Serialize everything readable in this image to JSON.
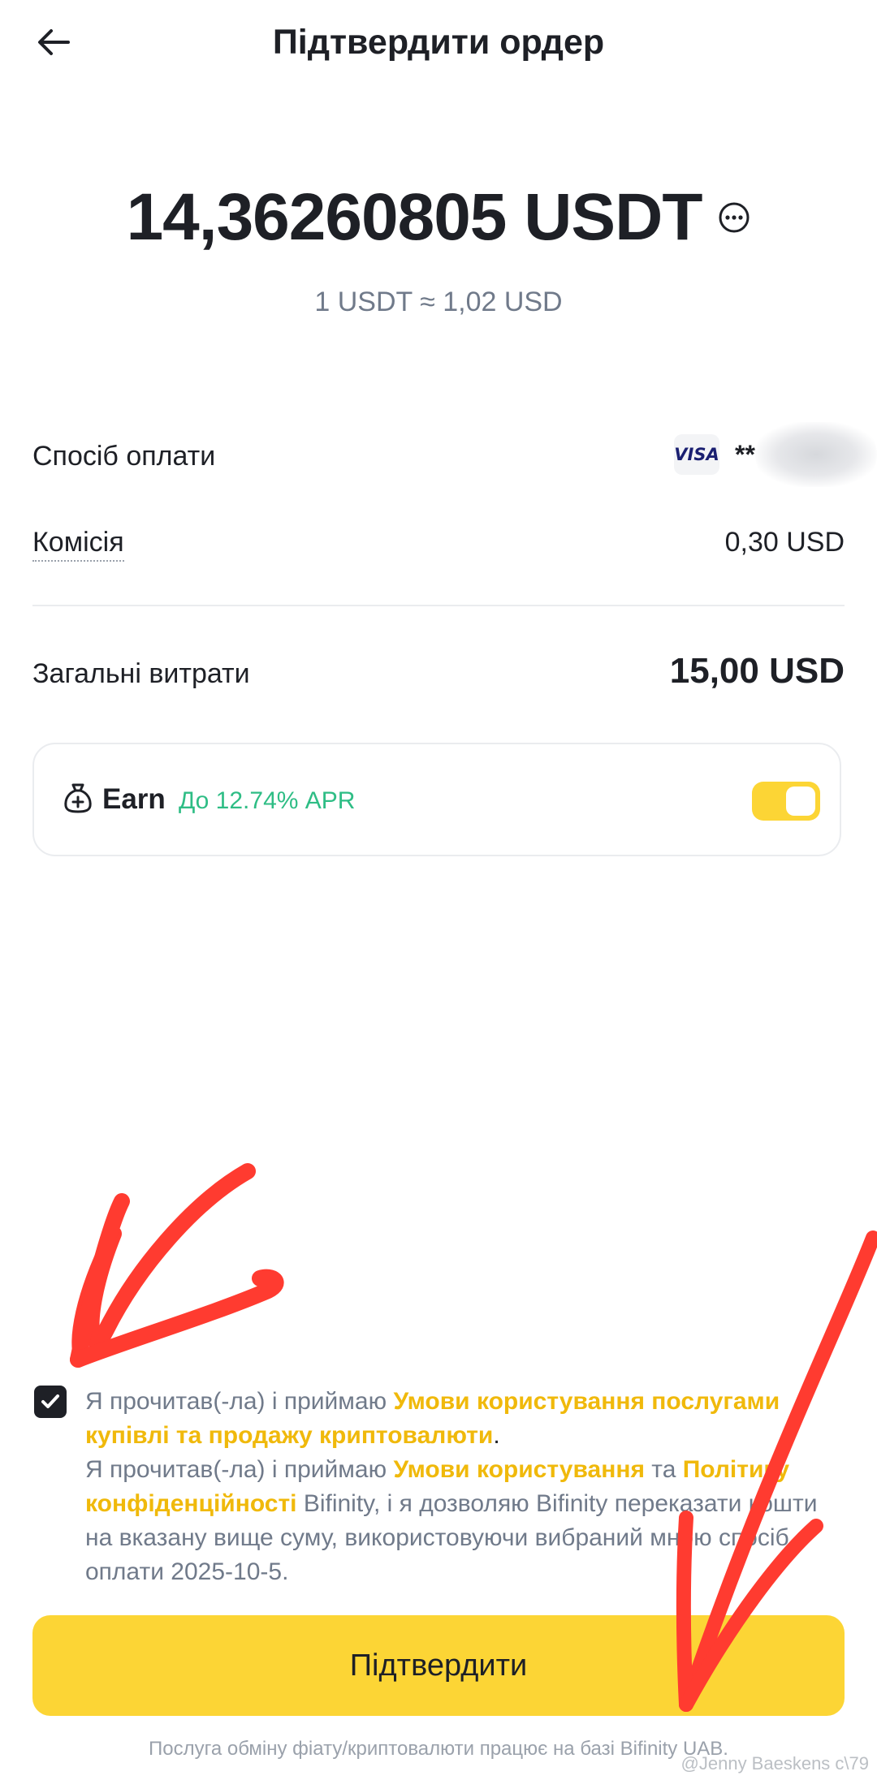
{
  "header": {
    "title": "Підтвердити ордер"
  },
  "order": {
    "amount": "14,36260805 USDT",
    "rate": "1 USDT ≈ 1,02 USD"
  },
  "details": {
    "payment_method_label": "Спосіб оплати",
    "payment_brand": "VISA",
    "card_mask": "**",
    "commission_label": "Комісія",
    "commission_value": "0,30 USD",
    "total_label": "Загальні витрати",
    "total_value": "15,00 USD"
  },
  "earn": {
    "title": "Earn",
    "apr": "До 12.74% APR",
    "enabled": true
  },
  "terms": {
    "checked": true,
    "p1_prefix": "Я прочитав(-ла) і приймаю ",
    "p1_link": "Умови користування послугами купівлі та продажу криптовалюти",
    "p1_suffix": ".",
    "p2_prefix": "Я прочитав(-ла) і приймаю ",
    "p2_link1": "Умови користування",
    "p2_and": " та ",
    "p2_link2": "Політику конфіденційності",
    "p2_suffix": " Bifinity, і я дозволяю Bifinity переказати кошти на вказану вище суму, використовуючи вибраний мною спосіб оплати 2025-10-5."
  },
  "actions": {
    "confirm_label": "Підтвердити"
  },
  "footer": {
    "note": "Послуга обміну фіату/криптовалюти працює на базі Bifinity UAB.",
    "watermark": "@Jenny Baeskens c\\79"
  },
  "colors": {
    "accent": "#fcd535",
    "link": "#f0b90b",
    "apr_green": "#2ebd85",
    "annotation_red": "#ff3b30"
  }
}
